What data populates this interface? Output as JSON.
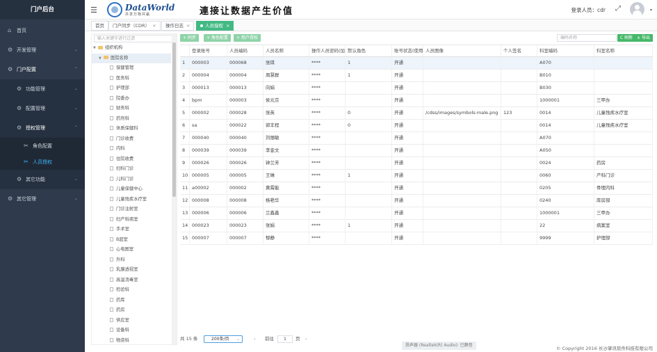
{
  "sidebar": {
    "title": "门户后台",
    "items": [
      {
        "label": "首页",
        "icon": "home-icon",
        "chev": ""
      },
      {
        "label": "开发管理",
        "icon": "gear-icon",
        "chev": "⌄"
      },
      {
        "label": "门户配置",
        "icon": "gear-icon",
        "chev": "⌃"
      },
      {
        "label": "功能管理",
        "icon": "gear-icon",
        "chev": "⌄"
      },
      {
        "label": "配置管理",
        "icon": "gear-icon",
        "chev": "⌄"
      },
      {
        "label": "授权管理",
        "icon": "gear-icon",
        "chev": "⌃"
      },
      {
        "label": "角色配置",
        "icon": "tools-icon",
        "chev": ""
      },
      {
        "label": "人员授权",
        "icon": "tools-icon",
        "chev": ""
      },
      {
        "label": "其它功能",
        "icon": "gear-icon",
        "chev": "⌄"
      },
      {
        "label": "其它管理",
        "icon": "gear-icon",
        "chev": "⌄"
      }
    ]
  },
  "header": {
    "logo_text": "DataWorld",
    "logo_sub": "共享万物共赢",
    "slogan": "連接让数据产生价值",
    "login_label": "登录人员：cdr"
  },
  "tabs": [
    {
      "label": "首页",
      "closable": false
    },
    {
      "label": "门户同步（CDR）",
      "closable": true
    },
    {
      "label": "操作日志",
      "closable": true
    },
    {
      "label": "人员授权",
      "closable": true,
      "active": true
    }
  ],
  "tree": {
    "placeholder": "输入关键字进行过滤",
    "root": "组织机构",
    "group": "医院名称",
    "departments": [
      "保健管理",
      "医务科",
      "护理部",
      "院委办",
      "财务科",
      "药剂科",
      "体质保健科",
      "门诊收费",
      "内科",
      "住院收费",
      "妇科门诊",
      "儿科门诊",
      "儿童保健中心",
      "儿童残疾水疗室",
      "门诊注射室",
      "妇产科病室",
      "手术室",
      "B超室",
      "心电图室",
      "外科",
      "乳腺透视室",
      "高温消毒室",
      "检验科",
      "药库",
      "药房",
      "供应室",
      "设备科",
      "物资科"
    ]
  },
  "toolbar": {
    "buttons": [
      "+ 同步",
      "+ 角色配置",
      "+ 用户授权"
    ],
    "search_placeholder": "编码名称",
    "search_button": "C 刷新",
    "export_button": "± 导出"
  },
  "table": {
    "headers": [
      "",
      "登录账号",
      "人员编码",
      "人员名称",
      "操作人员密码(加密)",
      "默认角色",
      "账号状态(使用)",
      "人员图像",
      "个人签名",
      "科室编码",
      "科室名称"
    ],
    "rows": [
      [
        "1",
        "000003",
        "000068",
        "张琪",
        "****",
        "1",
        "开通",
        "",
        "",
        "A070",
        ""
      ],
      [
        "2",
        "000004",
        "000004",
        "周慧群",
        "****",
        "1",
        "开通",
        "",
        "",
        "B010",
        ""
      ],
      [
        "3",
        "000013",
        "000013",
        "向娟",
        "****",
        "",
        "开通",
        "",
        "",
        "B030",
        ""
      ],
      [
        "4",
        "bpm",
        "000003",
        "侯元京",
        "****",
        "",
        "开通",
        "",
        "",
        "1000001",
        "三甲办"
      ],
      [
        "5",
        "000002",
        "000028",
        "张英",
        "****",
        "0",
        "开通",
        "/cdss/images/symbols-male.png",
        "123",
        "0014",
        "儿童残疾水疗室"
      ],
      [
        "6",
        "sa",
        "000022",
        "郭丰程",
        "****",
        "0",
        "开通",
        "",
        "",
        "0014",
        "儿童残疾水疗室"
      ],
      [
        "7",
        "000040",
        "000040",
        "刘丽敏",
        "****",
        "",
        "开通",
        "",
        "",
        "A070",
        ""
      ],
      [
        "8",
        "000039",
        "000039",
        "李金文",
        "****",
        "",
        "开通",
        "",
        "",
        "A050",
        ""
      ],
      [
        "9",
        "000026",
        "000026",
        "钟兰芳",
        "****",
        "",
        "开通",
        "",
        "",
        "0024",
        "药房"
      ],
      [
        "10",
        "000005",
        "000005",
        "王琳",
        "****",
        "1",
        "开通",
        "",
        "",
        "0060",
        "产科门诊"
      ],
      [
        "11",
        "a00002",
        "000002",
        "黄霄能",
        "****",
        "",
        "开通",
        "",
        "",
        "0205",
        "骨理内科"
      ],
      [
        "12",
        "000008",
        "000008",
        "杨艳华",
        "****",
        "",
        "开通",
        "",
        "",
        "0240",
        "库房部"
      ],
      [
        "13",
        "000006",
        "000006",
        "兰鑫鑫",
        "****",
        "",
        "开通",
        "",
        "",
        "1000001",
        "三甲办"
      ],
      [
        "14",
        "000023",
        "000023",
        "张娟",
        "****",
        "1",
        "开通",
        "",
        "",
        "22",
        "病案室"
      ],
      [
        "15",
        "000007",
        "000007",
        "郁静",
        "****",
        "",
        "开通",
        "",
        "",
        "9999",
        "护理部"
      ]
    ]
  },
  "pagination": {
    "total": "共 15 条",
    "page_size": "200条/页",
    "goto": "前往",
    "page": "1",
    "page_unit": "页"
  },
  "toast": "扬声器 (Realtek(R) Audio): 已静音",
  "copyright": "© Copyright 2016 长沙掌讯软件科技有限公司"
}
